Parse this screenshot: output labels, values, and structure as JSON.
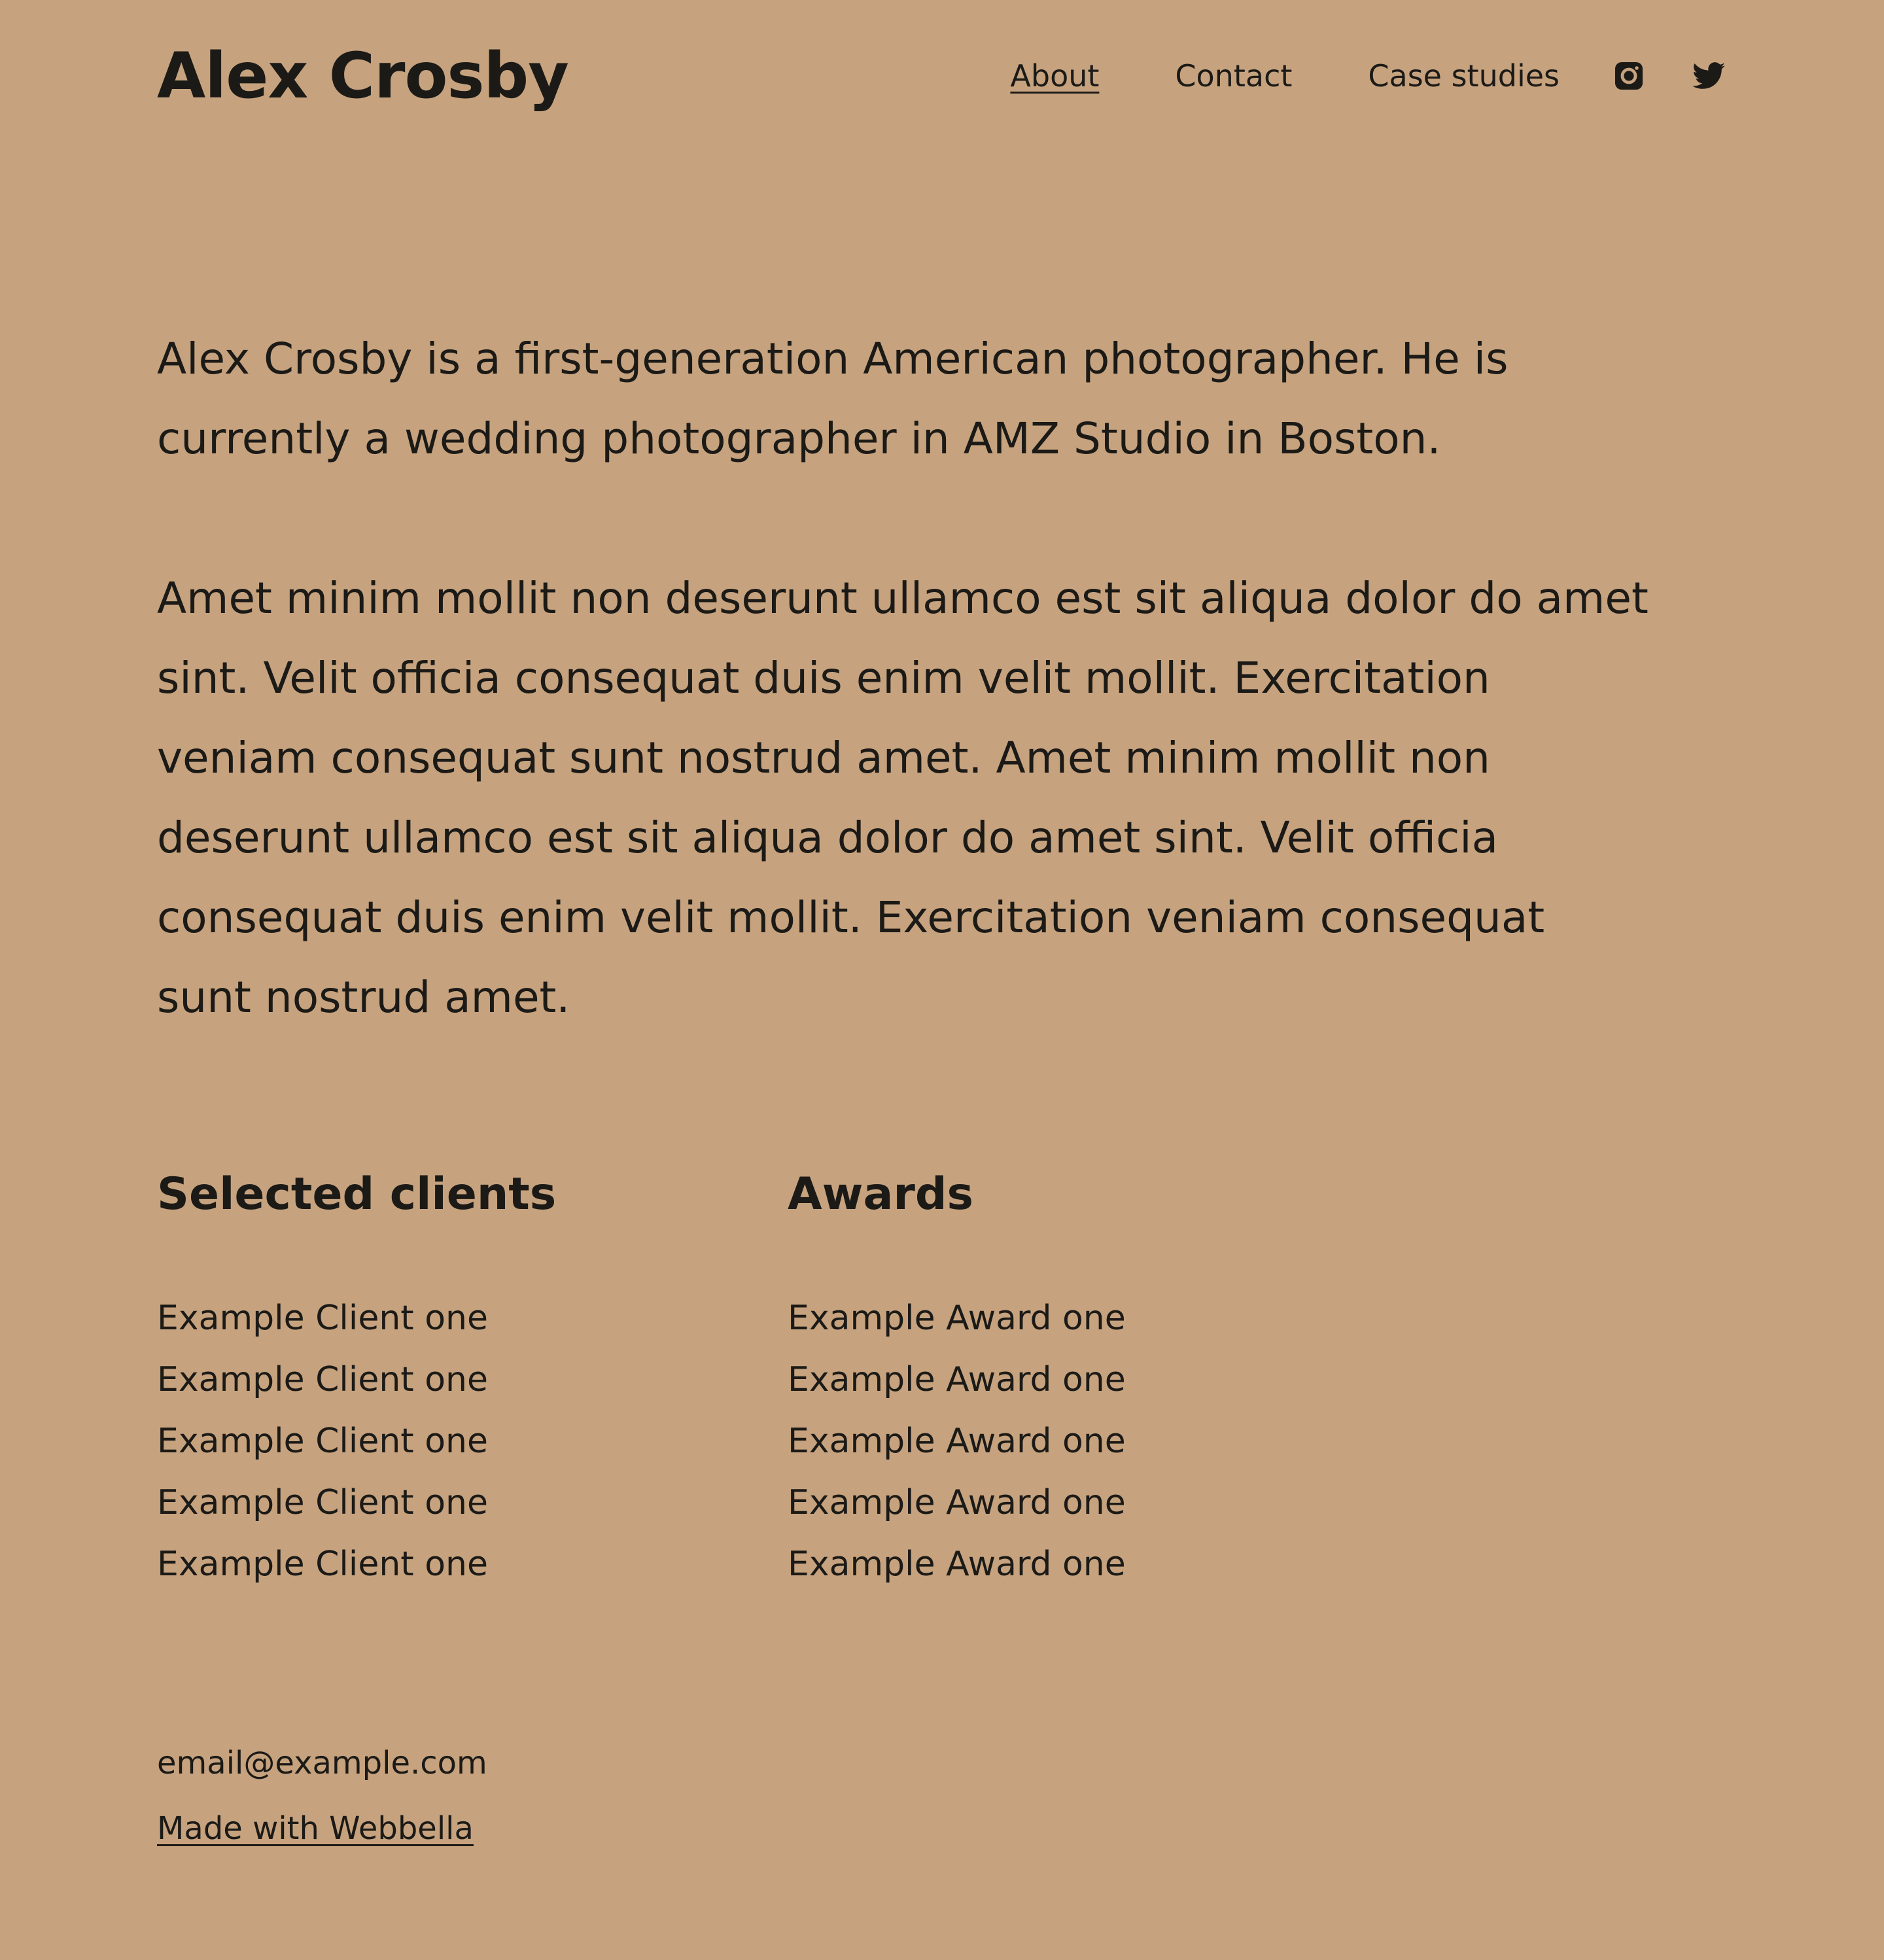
{
  "site": {
    "name": "Alex Crosby"
  },
  "nav": {
    "items": [
      {
        "label": "About"
      },
      {
        "label": "Contact"
      },
      {
        "label": "Case studies"
      }
    ],
    "icons": [
      "instagram-icon",
      "twitter-icon"
    ]
  },
  "intro": {
    "text": "Alex Crosby is a first-generation American photographer. He is currently a wedding photographer in AMZ Studio in Boston."
  },
  "body": {
    "text": "Amet minim mollit non deserunt ullamco est sit aliqua dolor do amet sint. Velit officia consequat duis enim velit mollit. Exercitation veniam consequat sunt nostrud amet. Amet minim mollit non deserunt ullamco est sit aliqua dolor do amet sint. Velit officia consequat duis enim velit mollit. Exercitation veniam consequat sunt nostrud amet."
  },
  "clients": {
    "title": "Selected clients",
    "items": [
      "Example Client one",
      "Example Client one",
      "Example Client one",
      "Example Client one",
      "Example Client one"
    ]
  },
  "awards": {
    "title": "Awards",
    "items": [
      "Example Award one",
      "Example Award one",
      "Example Award one",
      "Example Award one",
      "Example Award one"
    ]
  },
  "footer": {
    "email": "email@example.com",
    "made_with": "Made with Webbella"
  },
  "colors": {
    "background": "#c6a37e",
    "text": "#1c1a17"
  }
}
